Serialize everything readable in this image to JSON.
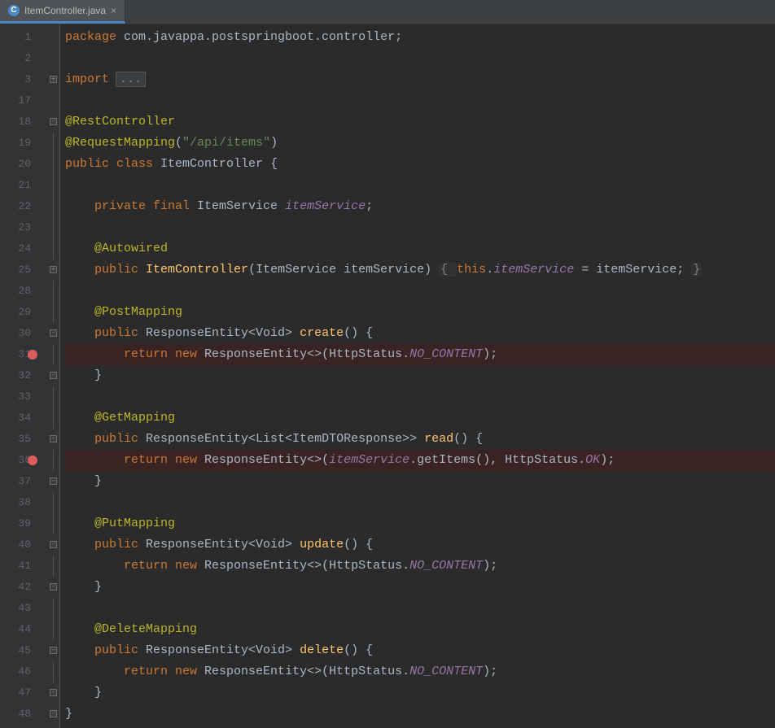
{
  "tab": {
    "filename": "ItemController.java",
    "icon_letter": "C",
    "close_glyph": "×"
  },
  "line_numbers": [
    "1",
    "2",
    "3",
    "17",
    "18",
    "19",
    "20",
    "21",
    "22",
    "23",
    "24",
    "25",
    "28",
    "29",
    "30",
    "31",
    "32",
    "33",
    "34",
    "35",
    "36",
    "37",
    "38",
    "39",
    "40",
    "41",
    "42",
    "43",
    "44",
    "45",
    "46",
    "47",
    "48"
  ],
  "breakpoints": [
    "31",
    "36"
  ],
  "marks": [
    "22",
    "25",
    "41",
    "46"
  ],
  "code": {
    "l1": {
      "kw_package": "package",
      "pkg": " com.javappa.postspringboot.controller",
      "semi": ";"
    },
    "l3": {
      "kw_import": "import ",
      "folded": "..."
    },
    "l18": {
      "anno": "@RestController"
    },
    "l19": {
      "anno": "@RequestMapping",
      "open": "(",
      "str": "\"/api/items\"",
      "close": ")"
    },
    "l20": {
      "kw_public": "public ",
      "kw_class": "class ",
      "name": "ItemController ",
      "brace": "{"
    },
    "l22": {
      "kw_private": "private ",
      "kw_final": "final ",
      "type": "ItemService ",
      "field": "itemService",
      "semi": ";"
    },
    "l24": {
      "anno": "@Autowired"
    },
    "l25": {
      "kw_public": "public ",
      "ctor": "ItemController",
      "open": "(",
      "ptype": "ItemService ",
      "pname": "itemService",
      "close": ") ",
      "dim_open": "{ ",
      "kw_this": "this",
      "dot": ".",
      "fld": "itemService",
      "eq": " = ",
      "arg": "itemService",
      "semi": "; ",
      "dim_close": "}"
    },
    "l29": {
      "anno": "@PostMapping"
    },
    "l30": {
      "kw_public": "public ",
      "ret": "ResponseEntity<Void> ",
      "mth": "create",
      "paren": "() {"
    },
    "l31": {
      "kw_return": "return ",
      "kw_new": "new ",
      "expr": "ResponseEntity<>(",
      "http": "HttpStatus.",
      "stat": "NO_CONTENT",
      "end": ");"
    },
    "l32": {
      "brace": "}"
    },
    "l34": {
      "anno": "@GetMapping"
    },
    "l35": {
      "kw_public": "public ",
      "ret": "ResponseEntity<List<ItemDTOResponse>> ",
      "mth": "read",
      "paren": "() {"
    },
    "l36": {
      "kw_return": "return ",
      "kw_new": "new ",
      "expr": "ResponseEntity<>(",
      "svc": "itemService",
      ".get": ".getItems(), ",
      "http": "HttpStatus.",
      "stat": "OK",
      "end": ");"
    },
    "l37": {
      "brace": "}"
    },
    "l39": {
      "anno": "@PutMapping"
    },
    "l40": {
      "kw_public": "public ",
      "ret": "ResponseEntity<Void> ",
      "mth": "update",
      "paren": "() {"
    },
    "l41": {
      "kw_return": "return ",
      "kw_new": "new ",
      "expr": "ResponseEntity<>(",
      "http": "HttpStatus.",
      "stat": "NO_CONTENT",
      "end": ");"
    },
    "l42": {
      "brace": "}"
    },
    "l44": {
      "anno": "@DeleteMapping"
    },
    "l45": {
      "kw_public": "public ",
      "ret": "ResponseEntity<Void> ",
      "mth": "delete",
      "paren": "() {"
    },
    "l46": {
      "kw_return": "return ",
      "kw_new": "new ",
      "expr": "ResponseEntity<>(",
      "http": "HttpStatus.",
      "stat": "NO_CONTENT",
      "end": ");"
    },
    "l47": {
      "brace": "}"
    },
    "l48": {
      "brace": "}"
    }
  }
}
